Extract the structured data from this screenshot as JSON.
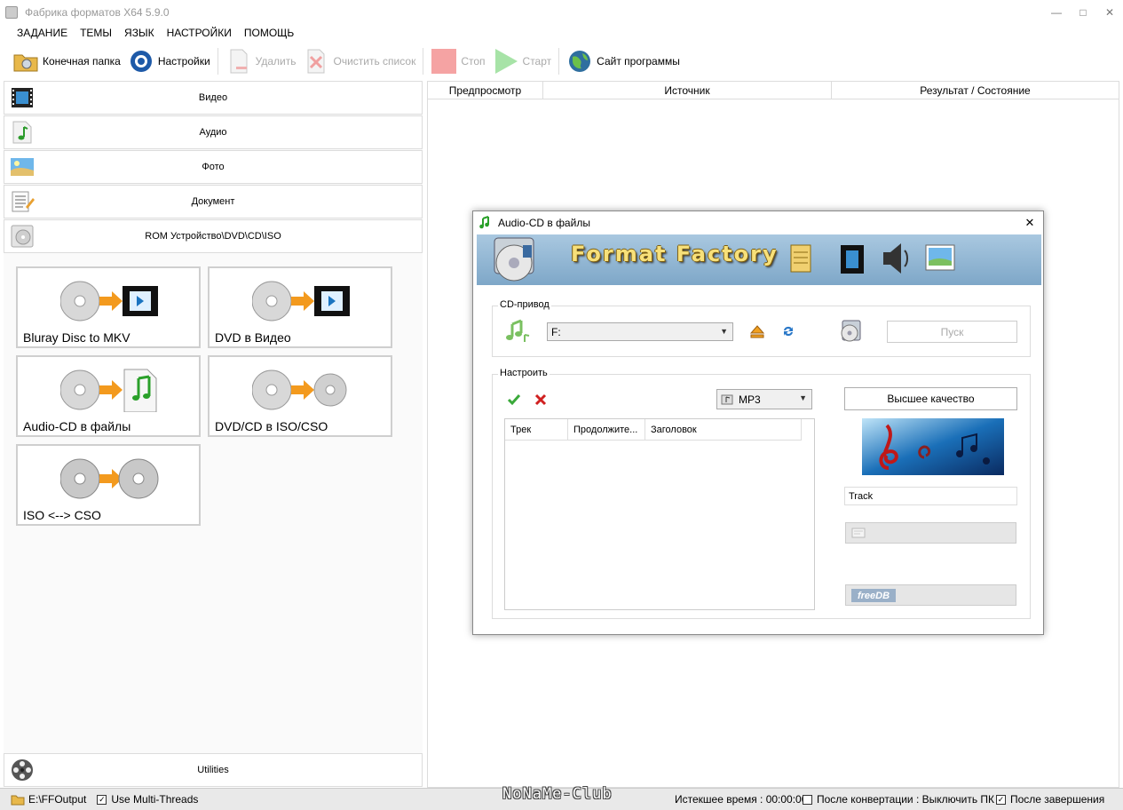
{
  "window": {
    "title": "Фабрика форматов X64 5.9.0"
  },
  "menu": [
    "ЗАДАНИЕ",
    "ТЕМЫ",
    "ЯЗЫК",
    "НАСТРОЙКИ",
    "ПОМОЩЬ"
  ],
  "toolbar": {
    "output_folder": "Конечная папка",
    "settings": "Настройки",
    "delete": "Удалить",
    "clear_list": "Очистить список",
    "stop": "Стоп",
    "start": "Старт",
    "website": "Сайт программы"
  },
  "categories": {
    "video": "Видео",
    "audio": "Аудио",
    "photo": "Фото",
    "document": "Документ",
    "rom": "ROM Устройство\\DVD\\CD\\ISO",
    "utilities": "Utilities"
  },
  "tiles": {
    "bluray": "Bluray Disc to MKV",
    "dvd_video": "DVD в Видео",
    "audio_cd": "Audio-CD в файлы",
    "dvd_iso": "DVD/CD в ISO/CSO",
    "iso_cso": "ISO <--> CSO"
  },
  "task_list": {
    "columns": [
      "Предпросмотр",
      "Источник",
      "Результат / Состояние"
    ]
  },
  "dialog": {
    "title": "Audio-CD в файлы",
    "banner": "Format Factory",
    "cd_group_label": "CD-привод",
    "drive_value": "F:",
    "start_button": "Пуск",
    "settings_group_label": "Настроить",
    "format_value": "MP3",
    "quality_button": "Высшее качество",
    "track_columns": [
      "Трек",
      "Продолжите...",
      "Заголовок"
    ],
    "track_name_value": "Track",
    "freedb_label": "freeDB"
  },
  "status": {
    "output_path": "E:\\FFOutput",
    "multithreads": "Use Multi-Threads",
    "elapsed": "Истекшее время : 00:00:00",
    "after_convert": "После конвертации : Выключить ПК",
    "after_finish": "После завершения"
  },
  "watermark": "NoNaMe-Club",
  "colors": {
    "accent_green": "#3aa93a",
    "stop_red": "#f5a3a3",
    "start_green": "#a7e3a7",
    "banner_blue": "#8fb5d4"
  }
}
